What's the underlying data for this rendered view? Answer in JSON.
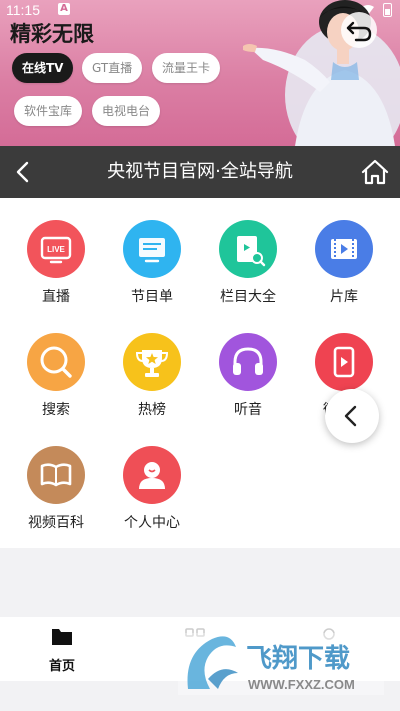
{
  "status_bar": {
    "time": "11:15",
    "indicator": "A"
  },
  "banner": {
    "title": "精彩无限",
    "chips": [
      "在线TV",
      "GT直播",
      "流量王卡",
      "软件宝库",
      "电视电台"
    ],
    "active_chip": "在线TV"
  },
  "navbar": {
    "title": "央视节目官网·全站导航"
  },
  "grid": [
    {
      "label": "直播",
      "icon": "live-tv-icon",
      "color": "#f2545b",
      "badge": "LIVE"
    },
    {
      "label": "节目单",
      "icon": "schedule-icon",
      "color": "#2fb4f0"
    },
    {
      "label": "栏目大全",
      "icon": "book-search-icon",
      "color": "#1fc59a"
    },
    {
      "label": "片库",
      "icon": "film-icon",
      "color": "#4a7de6"
    },
    {
      "label": "搜索",
      "icon": "search-icon",
      "color": "#f7a544"
    },
    {
      "label": "热榜",
      "icon": "trophy-icon",
      "color": "#f7c21b"
    },
    {
      "label": "听音",
      "icon": "headphones-icon",
      "color": "#a155dd"
    },
    {
      "label": "微视频",
      "icon": "video-phone-icon",
      "color": "#ef4351"
    },
    {
      "label": "视频百科",
      "icon": "open-book-icon",
      "color": "#c48a5a"
    },
    {
      "label": "个人中心",
      "icon": "person-icon",
      "color": "#ef4f56"
    }
  ],
  "tabs": [
    {
      "label": "首页",
      "icon": "folder-icon",
      "active": true
    }
  ],
  "watermark": {
    "text": "飞翔下载",
    "url_text": "WWW.FXXZ.COM"
  }
}
